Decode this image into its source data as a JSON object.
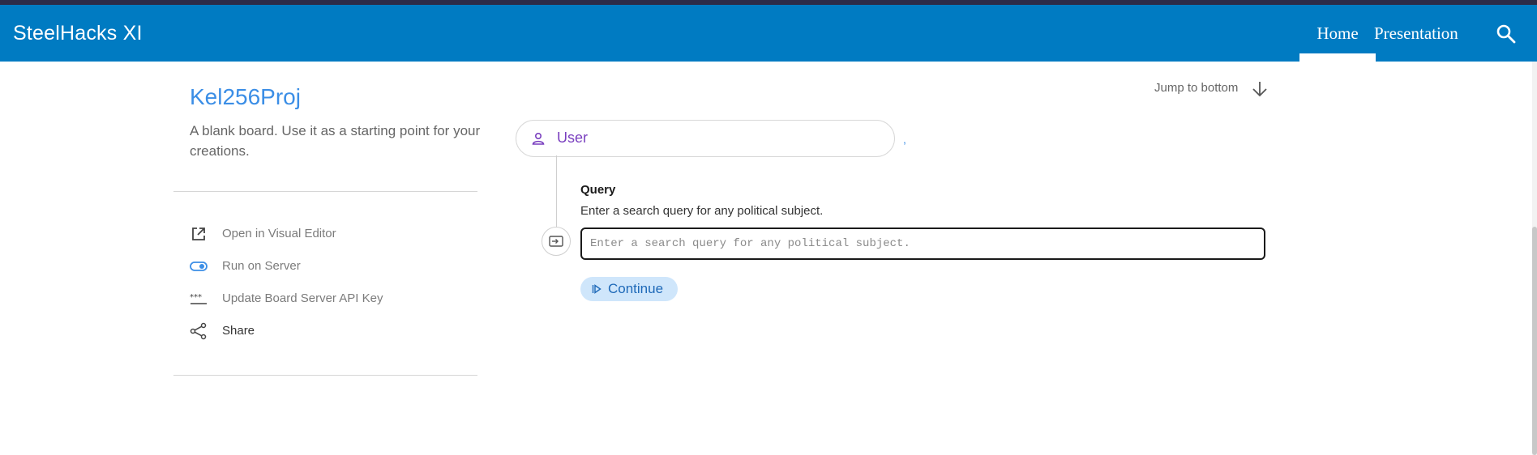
{
  "header": {
    "brand": "SteelHacks XI",
    "nav": [
      {
        "label": "Home",
        "active": true
      },
      {
        "label": "Presentation",
        "active": false
      }
    ],
    "search_icon": "search-icon"
  },
  "board": {
    "title": "Kel256Proj",
    "description": "A blank board. Use it as a starting point for your creations."
  },
  "menu": [
    {
      "label": "Open in Visual Editor",
      "icon": "open-external-icon"
    },
    {
      "label": "Run on Server",
      "icon": "toggle-icon"
    },
    {
      "label": "Update Board Server API Key",
      "icon": "password-key-icon"
    },
    {
      "label": "Share",
      "icon": "share-icon"
    }
  ],
  "jump": {
    "label": "Jump to bottom",
    "icon": "arrow-down-icon"
  },
  "user": {
    "label": "User",
    "icon": "person-icon"
  },
  "query": {
    "label": "Query",
    "description": "Enter a search query for any political subject.",
    "placeholder": "Enter a search query for any political subject.",
    "value": ""
  },
  "continue": {
    "label": "Continue",
    "icon": "play-icon"
  },
  "colors": {
    "header_bg": "#007bc2",
    "title": "#3b8ee6",
    "user_label": "#7a3fbf",
    "continue_bg": "#cfe6fb",
    "continue_text": "#1e69b8"
  }
}
